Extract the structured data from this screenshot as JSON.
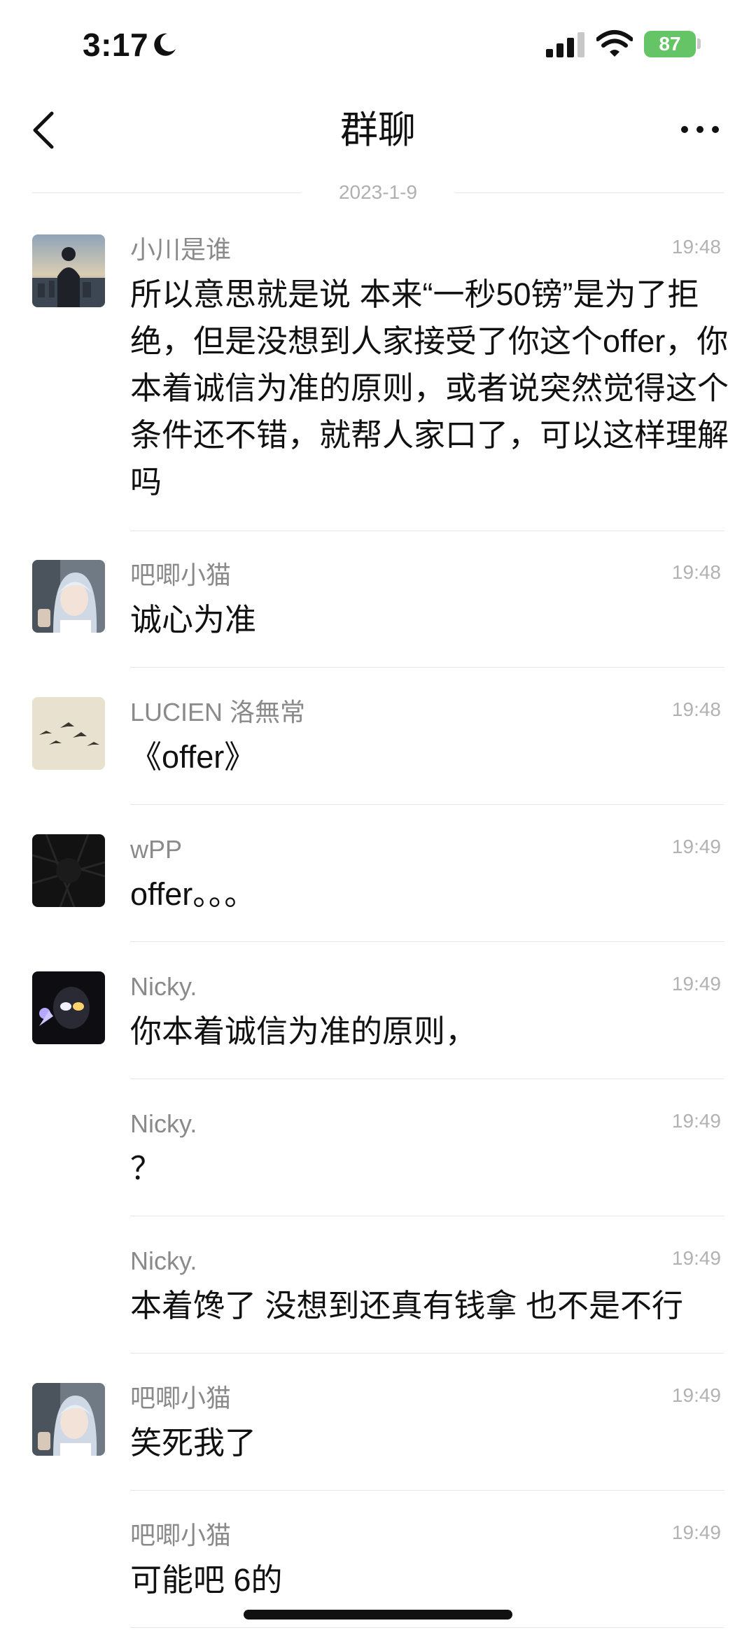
{
  "status_bar": {
    "time": "3:17",
    "battery_level": "87",
    "battery_color": "#65c466"
  },
  "nav": {
    "title": "群聊",
    "back_icon": "chevron-left-icon",
    "more_icon": "ellipsis-icon"
  },
  "date_separator": "2023-1-9",
  "messages": [
    {
      "name": "小川是谁",
      "time": "19:48",
      "text": "所以意思就是说 本来“一秒50镑”是为了拒绝，但是没想到人家接受了你这个offer，你本着诚信为准的原则，或者说突然觉得这个条件还不错，就帮人家口了，可以这样理解吗",
      "avatar": "landscape-person-avatar"
    },
    {
      "name": "吧唧小猫",
      "time": "19:48",
      "text": "诚心为准",
      "avatar": "girl-selfie-avatar"
    },
    {
      "name": "LUCIEN 洛無常",
      "time": "19:48",
      "text": "《offer》",
      "avatar": "birds-avatar"
    },
    {
      "name": "wPP",
      "time": "19:49",
      "text": "offer。。。",
      "avatar": "dark-avatar"
    },
    {
      "name": "Nicky.",
      "time": "19:49",
      "text": "你本着诚信为准的原则，",
      "avatar": "glowing-figure-avatar"
    },
    {
      "name": "Nicky.",
      "time": "19:49",
      "text": "？"
    },
    {
      "name": "Nicky.",
      "time": "19:49",
      "text": "本着馋了 没想到还真有钱拿  也不是不行"
    },
    {
      "name": "吧唧小猫",
      "time": "19:49",
      "text": "笑死我了",
      "avatar": "girl-selfie-avatar"
    },
    {
      "name": "吧唧小猫",
      "time": "19:49",
      "text": "可能吧 6的"
    }
  ]
}
